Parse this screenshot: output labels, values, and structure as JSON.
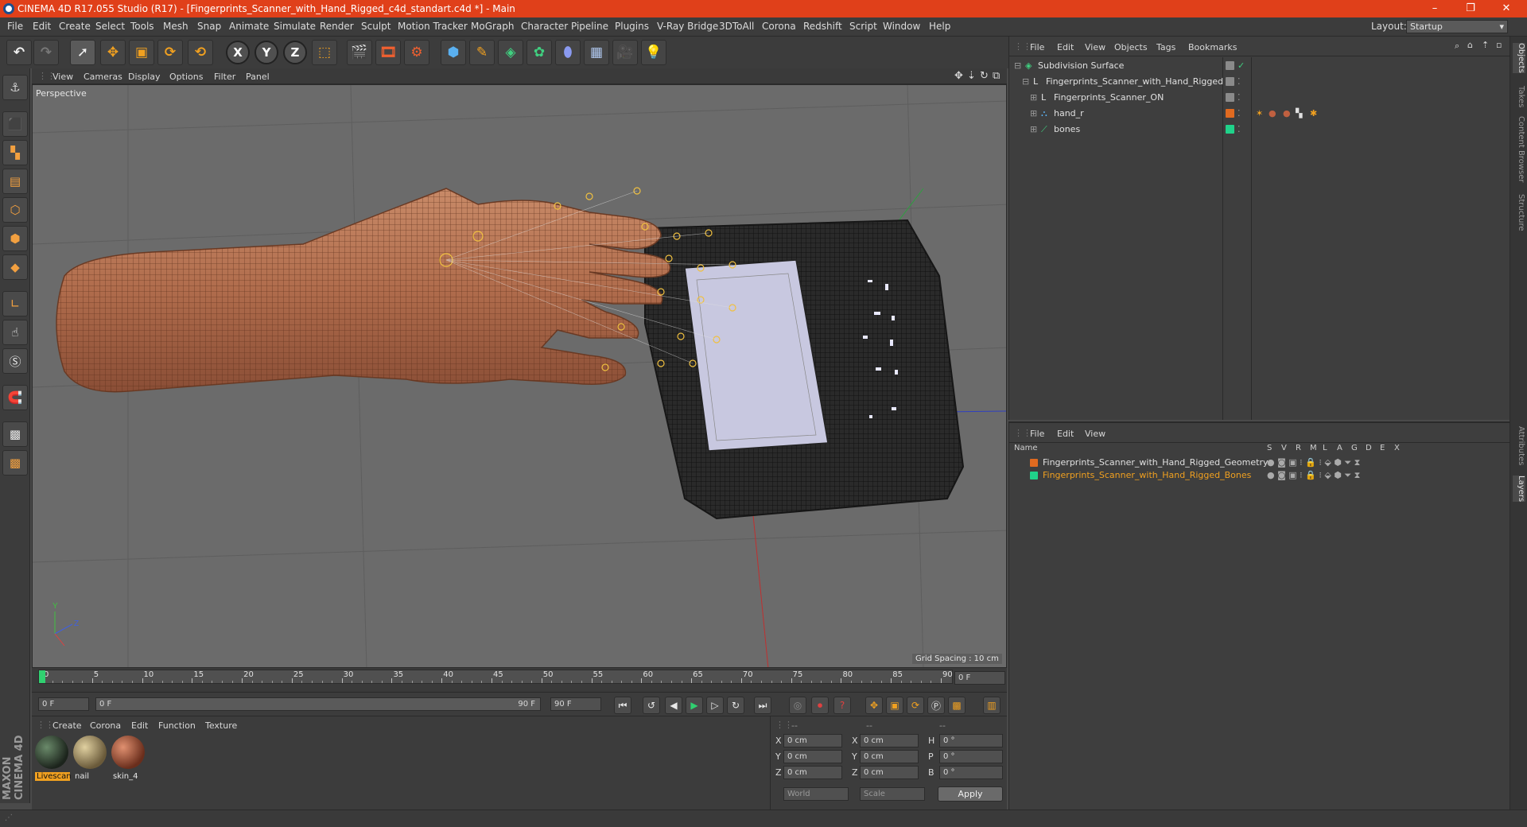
{
  "titlebar": {
    "title": "CINEMA 4D R17.055 Studio (R17) - [Fingerprints_Scanner_with_Hand_Rigged_c4d_standart.c4d *] - Main",
    "minimize": "–",
    "restore": "❐",
    "close": "✕"
  },
  "menubar": {
    "items": [
      "File",
      "Edit",
      "Create",
      "Select",
      "Tools",
      "Mesh",
      "Snap",
      "Animate",
      "Simulate",
      "Render",
      "Sculpt",
      "Motion Tracker",
      "MoGraph",
      "Character",
      "Pipeline",
      "Plugins",
      "V-Ray Bridge",
      "3DToAll",
      "Corona",
      "Redshift",
      "Script",
      "Window",
      "Help"
    ],
    "layout_label": "Layout:",
    "layout_value": "Startup"
  },
  "toolbar": {
    "axis_x": "X",
    "axis_y": "Y",
    "axis_z": "Z"
  },
  "viewport": {
    "menu": [
      "View",
      "Cameras",
      "Display",
      "Options",
      "Filter",
      "Panel"
    ],
    "camera_label": "Perspective",
    "grid_spacing": "Grid Spacing : 10 cm"
  },
  "timeline": {
    "ticks": [
      "0",
      "5",
      "10",
      "15",
      "20",
      "25",
      "30",
      "35",
      "40",
      "45",
      "50",
      "55",
      "60",
      "65",
      "70",
      "75",
      "80",
      "85",
      "90"
    ],
    "current_frame": "0 F",
    "start_frame": "0 F",
    "range_start": "0 F",
    "range_end": "90 F",
    "end_frame": "90 F"
  },
  "materials": {
    "menu": [
      "Create",
      "Corona",
      "Edit",
      "Function",
      "Texture"
    ],
    "items": [
      {
        "name": "Livescan",
        "color": "#2f3a30",
        "selected": true
      },
      {
        "name": "nail",
        "color": "#9a8a66",
        "selected": false
      },
      {
        "name": "skin_4",
        "color": "#a6553a",
        "selected": false
      }
    ]
  },
  "coordinates": {
    "header": [
      "--",
      "--",
      "--"
    ],
    "rows": [
      {
        "a_label": "X",
        "a_val": "0 cm",
        "b_label": "X",
        "b_val": "0 cm",
        "c_label": "H",
        "c_val": "0 °"
      },
      {
        "a_label": "Y",
        "a_val": "0 cm",
        "b_label": "Y",
        "b_val": "0 cm",
        "c_label": "P",
        "c_val": "0 °"
      },
      {
        "a_label": "Z",
        "a_val": "0 cm",
        "b_label": "Z",
        "b_val": "0 cm",
        "c_label": "B",
        "c_val": "0 °"
      }
    ],
    "space": "World",
    "mode": "Scale",
    "apply": "Apply"
  },
  "object_manager": {
    "menu": [
      "File",
      "Edit",
      "View",
      "Objects",
      "Tags",
      "Bookmarks"
    ],
    "objects": [
      {
        "name": "Subdivision Surface",
        "indent": 0,
        "color": "#8a8a8a"
      },
      {
        "name": "Fingerprints_Scanner_with_Hand_Rigged",
        "indent": 1,
        "color": "#8a8a8a"
      },
      {
        "name": "Fingerprints_Scanner_ON",
        "indent": 2,
        "color": "#8a8a8a"
      },
      {
        "name": "hand_r",
        "indent": 2,
        "color": "#e06a20"
      },
      {
        "name": "bones",
        "indent": 2,
        "color": "#20d28a"
      }
    ]
  },
  "layer_manager": {
    "menu": [
      "File",
      "Edit",
      "View"
    ],
    "columns": [
      "Name",
      "S",
      "V",
      "R",
      "M",
      "L",
      "A",
      "G",
      "D",
      "E",
      "X"
    ],
    "layers": [
      {
        "name": "Fingerprints_Scanner_with_Hand_Rigged_Geometry",
        "color": "#e06a20"
      },
      {
        "name": "Fingerprints_Scanner_with_Hand_Rigged_Bones",
        "color": "#20d28a"
      }
    ]
  },
  "right_rail": [
    "Objects",
    "Takes",
    "Content Browser",
    "Structure",
    "Attributes",
    "Layers"
  ],
  "branding": "MAXON CINEMA 4D",
  "colors": {
    "title_accent": "#e0401a",
    "selection_orange": "#f0a020"
  }
}
